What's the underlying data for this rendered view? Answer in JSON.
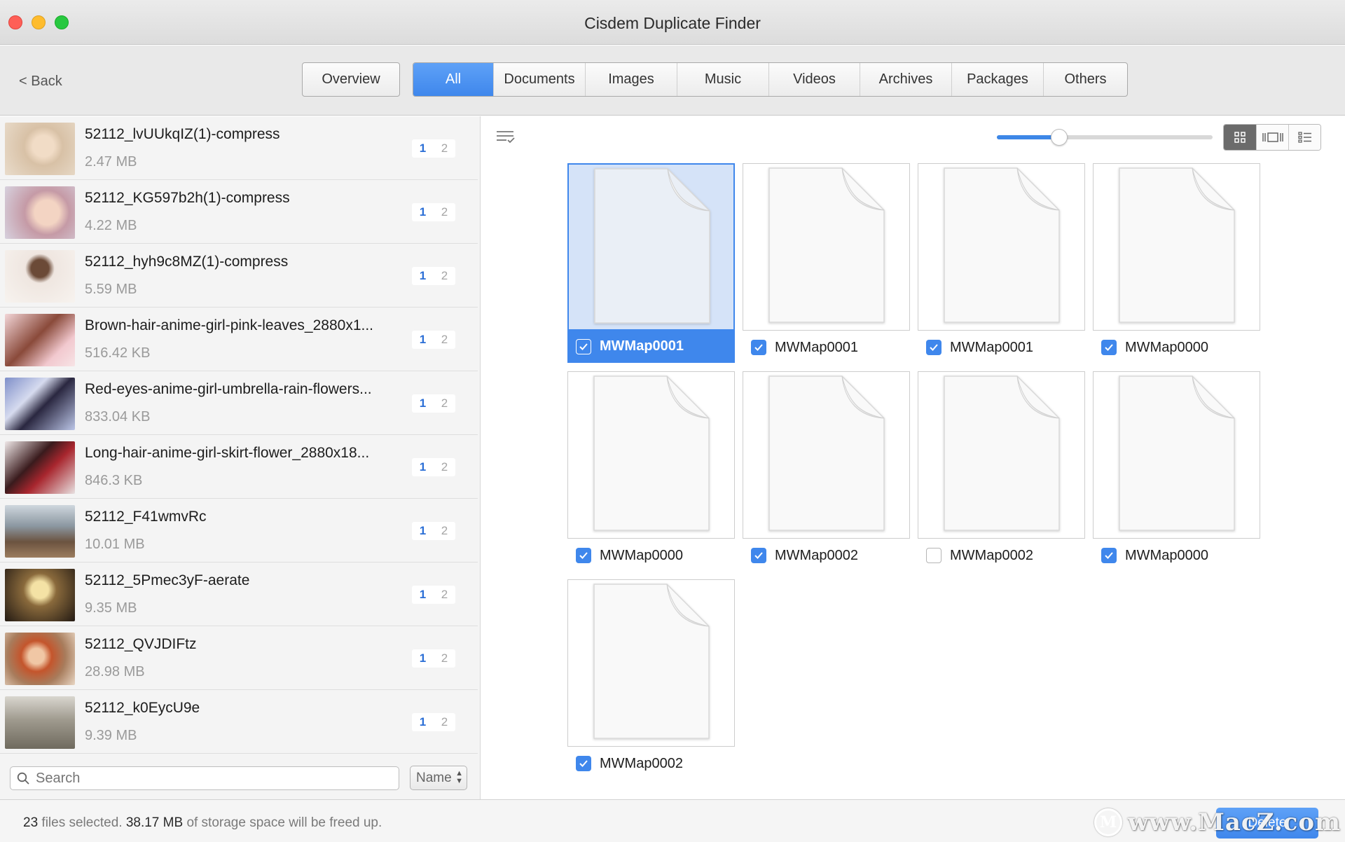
{
  "window": {
    "title": "Cisdem Duplicate Finder"
  },
  "toolbar": {
    "back_label": "< Back",
    "overview_label": "Overview",
    "tabs": [
      {
        "label": "All",
        "active": true
      },
      {
        "label": "Documents"
      },
      {
        "label": "Images"
      },
      {
        "label": "Music"
      },
      {
        "label": "Videos"
      },
      {
        "label": "Archives"
      },
      {
        "label": "Packages"
      },
      {
        "label": "Others"
      }
    ]
  },
  "sidebar": {
    "items": [
      {
        "name": "52112_lvUUkqIZ(1)-compress",
        "size": "2.47 MB",
        "badge": [
          "1",
          "2"
        ]
      },
      {
        "name": "52112_KG597b2h(1)-compress",
        "size": "4.22 MB",
        "badge": [
          "1",
          "2"
        ]
      },
      {
        "name": "52112_hyh9c8MZ(1)-compress",
        "size": "5.59 MB",
        "badge": [
          "1",
          "2"
        ]
      },
      {
        "name": "Brown-hair-anime-girl-pink-leaves_2880x1...",
        "size": "516.42 KB",
        "badge": [
          "1",
          "2"
        ]
      },
      {
        "name": "Red-eyes-anime-girl-umbrella-rain-flowers...",
        "size": "833.04 KB",
        "badge": [
          "1",
          "2"
        ]
      },
      {
        "name": "Long-hair-anime-girl-skirt-flower_2880x18...",
        "size": "846.3 KB",
        "badge": [
          "1",
          "2"
        ]
      },
      {
        "name": "52112_F41wmvRc",
        "size": "10.01 MB",
        "badge": [
          "1",
          "2"
        ]
      },
      {
        "name": "52112_5Pmec3yF-aerate",
        "size": "9.35 MB",
        "badge": [
          "1",
          "2"
        ]
      },
      {
        "name": "52112_QVJDIFtz",
        "size": "28.98 MB",
        "badge": [
          "1",
          "2"
        ]
      },
      {
        "name": "52112_k0EycU9e",
        "size": "9.39 MB",
        "badge": [
          "1",
          "2"
        ]
      }
    ],
    "search_placeholder": "Search",
    "sort_value": "Name"
  },
  "viewer": {
    "zoom_level": 0.27,
    "view_modes": [
      "grid-view-icon",
      "filmstrip-view-icon",
      "list-view-icon"
    ],
    "files": [
      {
        "name": "MWMap0001",
        "checked": true,
        "selected": true
      },
      {
        "name": "MWMap0001",
        "checked": true
      },
      {
        "name": "MWMap0001",
        "checked": true
      },
      {
        "name": "MWMap0000",
        "checked": true
      },
      {
        "name": "MWMap0000",
        "checked": true
      },
      {
        "name": "MWMap0002",
        "checked": true
      },
      {
        "name": "MWMap0002",
        "checked": false
      },
      {
        "name": "MWMap0000",
        "checked": true
      },
      {
        "name": "MWMap0002",
        "checked": true
      }
    ]
  },
  "status": {
    "count": "23",
    "count_suffix": "files selected.",
    "size": "38.17 MB",
    "size_suffix": "of storage space will be freed up.",
    "delete_label": "Delete"
  },
  "watermark": {
    "text": "www.MacZ.com"
  },
  "colors": {
    "accent": "#3f87ec",
    "selection_bg": "#d5e3f8"
  }
}
